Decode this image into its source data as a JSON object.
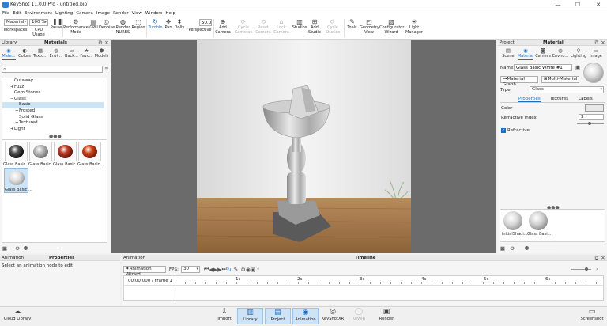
{
  "window": {
    "title": "KeyShot 11.0.0 Pro  - untitled.bip",
    "minimize": "—",
    "maximize": "☐",
    "close": "✕"
  },
  "menu": [
    "File",
    "Edit",
    "Environment",
    "Lighting",
    "Camera",
    "Image",
    "Render",
    "View",
    "Window",
    "Help"
  ],
  "toolbar": {
    "workspace_value": "Material",
    "cpu_value": "100 %",
    "perspective_value": "50.0",
    "items": [
      {
        "label": "Workspaces",
        "icon": "workspaces-icon",
        "glyph": "▦"
      },
      {
        "label": "CPU Usage",
        "icon": "cpu-icon",
        "glyph": "▣"
      },
      {
        "label": "Pause",
        "icon": "pause-icon",
        "glyph": "❚❚"
      },
      {
        "label": "Performance\nMode",
        "icon": "performance-icon",
        "glyph": "⚙"
      },
      {
        "label": "GPU",
        "icon": "gpu-icon",
        "glyph": "▤"
      },
      {
        "label": "Denoise",
        "icon": "denoise-icon",
        "glyph": "◎"
      },
      {
        "label": "Render\nNURBS",
        "icon": "nurbs-icon",
        "glyph": "◍"
      },
      {
        "label": "Region",
        "icon": "region-icon",
        "glyph": "⬚"
      },
      {
        "label": "Tumble",
        "icon": "tumble-icon",
        "glyph": "↻"
      },
      {
        "label": "Pan",
        "icon": "pan-icon",
        "glyph": "✥"
      },
      {
        "label": "Dolly",
        "icon": "dolly-icon",
        "glyph": "⬍"
      },
      {
        "label": "Perspective",
        "icon": "perspective-icon",
        "glyph": ""
      },
      {
        "label": "Add\nCamera",
        "icon": "add-camera-icon",
        "glyph": "⊕"
      },
      {
        "label": "Cycle\nCameras",
        "icon": "cycle-cameras-icon",
        "glyph": "⟳"
      },
      {
        "label": "Reset\nCamera",
        "icon": "reset-camera-icon",
        "glyph": "⟲"
      },
      {
        "label": "Lock\nCamera",
        "icon": "lock-camera-icon",
        "glyph": "🔒"
      },
      {
        "label": "Studios",
        "icon": "studios-icon",
        "glyph": "▥"
      },
      {
        "label": "Add\nStudio",
        "icon": "add-studio-icon",
        "glyph": "⊞"
      },
      {
        "label": "Cycle\nStudios",
        "icon": "cycle-studios-icon",
        "glyph": "⟳"
      },
      {
        "label": "Tools",
        "icon": "tools-icon",
        "glyph": "✎"
      },
      {
        "label": "Geometry\nView",
        "icon": "geometry-view-icon",
        "glyph": "◰"
      },
      {
        "label": "Configurator\nWizard",
        "icon": "configurator-icon",
        "glyph": "▧"
      },
      {
        "label": "Light\nManager",
        "icon": "light-manager-icon",
        "glyph": "☀"
      }
    ]
  },
  "library": {
    "title_left": "Library",
    "title": "Materials",
    "tabs": [
      {
        "label": "Mate...",
        "icon": "materials-icon",
        "glyph": "◉"
      },
      {
        "label": "Colors",
        "icon": "colors-icon",
        "glyph": "◐"
      },
      {
        "label": "Textu...",
        "icon": "textures-icon",
        "glyph": "▦"
      },
      {
        "label": "Envir...",
        "icon": "environments-icon",
        "glyph": "◍"
      },
      {
        "label": "Back...",
        "icon": "backplates-icon",
        "glyph": "▭"
      },
      {
        "label": "Favo...",
        "icon": "favorites-icon",
        "glyph": "★"
      },
      {
        "label": "Models",
        "icon": "models-icon",
        "glyph": "⬢"
      }
    ],
    "tree": [
      {
        "label": "Cutaway",
        "indent": 1,
        "toggle": ""
      },
      {
        "label": "Fuzz",
        "indent": 1,
        "toggle": "+"
      },
      {
        "label": "Gem Stones",
        "indent": 1,
        "toggle": ""
      },
      {
        "label": "Glass",
        "indent": 1,
        "toggle": "−"
      },
      {
        "label": "Basic",
        "indent": 2,
        "toggle": "",
        "selected": true
      },
      {
        "label": "Frosted",
        "indent": 2,
        "toggle": "+"
      },
      {
        "label": "Solid Glass",
        "indent": 2,
        "toggle": ""
      },
      {
        "label": "Textured",
        "indent": 2,
        "toggle": "+"
      },
      {
        "label": "Light",
        "indent": 1,
        "toggle": "+"
      }
    ],
    "thumbs": [
      {
        "label": "Glass Basic ...",
        "color": "#1a1a1a"
      },
      {
        "label": "Glass Basic ...",
        "color": "#a8a8a8"
      },
      {
        "label": "Glass Basic ...",
        "color": "#b03020"
      },
      {
        "label": "Glass Basic ...",
        "color": "#c23a1c"
      },
      {
        "label": "Glass Basic ...",
        "color": "#e8e8e8"
      }
    ]
  },
  "project": {
    "title_left": "Project",
    "title": "Material",
    "tabs": [
      {
        "label": "Scene",
        "icon": "scene-icon",
        "glyph": "▤"
      },
      {
        "label": "Material",
        "icon": "material-icon",
        "glyph": "◉"
      },
      {
        "label": "Camera",
        "icon": "camera-icon",
        "glyph": "◙"
      },
      {
        "label": "Enviro...",
        "icon": "environment-icon",
        "glyph": "◍"
      },
      {
        "label": "Lighting",
        "icon": "lighting-icon",
        "glyph": "♀"
      },
      {
        "label": "Image",
        "icon": "image-icon",
        "glyph": "▭"
      }
    ],
    "name_label": "Name:",
    "name_value": "Glass Basic White #1",
    "material_graph": "Material Graph",
    "multi_material": "Multi-Material",
    "type_label": "Type:",
    "type_value": "Glass",
    "subtabs": [
      "Properties",
      "Textures",
      "Labels"
    ],
    "color_label": "Color",
    "color_swatch": "#e8e8e8",
    "refractive_index_label": "Refractive Index",
    "refractive_index_value": "3",
    "refractive_label": "Refractive",
    "refractive_checked": true,
    "materials": [
      {
        "label": "initialShadi...",
        "color": "#d8d8d8"
      },
      {
        "label": "Glass Basi...",
        "color": "#cfcfcf"
      }
    ]
  },
  "animation": {
    "panel_left": "Animation",
    "panel_title": "Properties",
    "hint": "Select an animation node to edit",
    "timeline_left": "Animation",
    "timeline_title": "Timeline",
    "wizard": "Animation Wizard",
    "fps_label": "FPS:",
    "fps_value": "30",
    "frame_readout": "00:00:000 / Frame 1",
    "ticks": [
      "1s",
      "2s",
      "3s",
      "4s",
      "5s",
      "6s"
    ]
  },
  "bottombar": {
    "cloud_library": "Cloud Library",
    "items": [
      {
        "label": "Import",
        "icon": "import-icon",
        "glyph": "⇩",
        "state": ""
      },
      {
        "label": "Library",
        "icon": "library-icon",
        "glyph": "▥",
        "state": "on"
      },
      {
        "label": "Project",
        "icon": "project-icon",
        "glyph": "▤",
        "state": "on"
      },
      {
        "label": "Animation",
        "icon": "animation-icon",
        "glyph": "◉",
        "state": "on"
      },
      {
        "label": "KeyShotXR",
        "icon": "keyshotxr-icon",
        "glyph": "◎",
        "state": ""
      },
      {
        "label": "KeyVR",
        "icon": "keyvr-icon",
        "glyph": "◯",
        "state": "dis"
      },
      {
        "label": "Render",
        "icon": "render-icon",
        "glyph": "▣",
        "state": ""
      }
    ],
    "screenshot": "Screenshot"
  }
}
